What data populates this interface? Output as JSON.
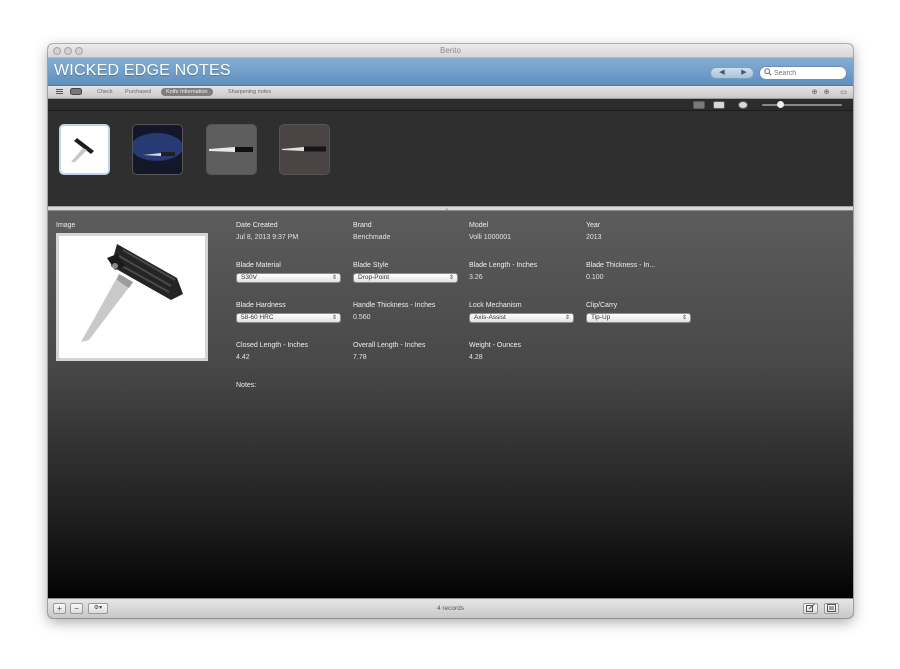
{
  "window": {
    "title": "Bento"
  },
  "header": {
    "app_title": "WICKED EDGE NOTES",
    "nav_back": "◀",
    "nav_forward": "▶",
    "search_placeholder": "Search"
  },
  "tabbar": {
    "tabs": [
      {
        "label": "Check"
      },
      {
        "label": "Purchased"
      },
      {
        "label": "Knife Information",
        "active": true
      },
      {
        "label": "Sharpening notes"
      }
    ]
  },
  "gallery": {
    "thumbnails": [
      {
        "name": "thumb-folding-knife",
        "selected": true
      },
      {
        "name": "thumb-knife-dark-blue",
        "selected": false
      },
      {
        "name": "thumb-kitchen-knife",
        "selected": false
      },
      {
        "name": "thumb-paring-knife",
        "selected": false
      }
    ]
  },
  "detail": {
    "image_label": "Image",
    "fields": {
      "date_created": {
        "label": "Date Created",
        "value": "Jul 8, 2013 9:37 PM"
      },
      "brand": {
        "label": "Brand",
        "value": "Benchmade"
      },
      "model": {
        "label": "Model",
        "value": "Volli 1000001"
      },
      "year": {
        "label": "Year",
        "value": "2013"
      },
      "blade_material": {
        "label": "Blade Material",
        "value": "S30V"
      },
      "blade_style": {
        "label": "Blade Style",
        "value": "Drop-Point"
      },
      "blade_length": {
        "label": "Blade Length - Inches",
        "value": "3.26"
      },
      "blade_thickness": {
        "label": "Blade Thickness - In...",
        "value": "0.100"
      },
      "blade_hardness": {
        "label": "Blade Hardness",
        "value": "58-60 HRC"
      },
      "handle_thickness": {
        "label": "Handle Thickness - Inches",
        "value": "0.560"
      },
      "lock_mechanism": {
        "label": "Lock Mechanism",
        "value": "Axis-Assist"
      },
      "clip_carry": {
        "label": "Clip/Carry",
        "value": "Tip-Up"
      },
      "closed_length": {
        "label": "Closed Length - Inches",
        "value": "4.42"
      },
      "overall_length": {
        "label": "Overall Length - Inches",
        "value": "7.78"
      },
      "weight": {
        "label": "Weight - Ounces",
        "value": "4.28"
      },
      "notes": {
        "label": "Notes:"
      }
    }
  },
  "statusbar": {
    "add": "+",
    "remove": "−",
    "gear": "⚙▾",
    "records": "4 records"
  }
}
